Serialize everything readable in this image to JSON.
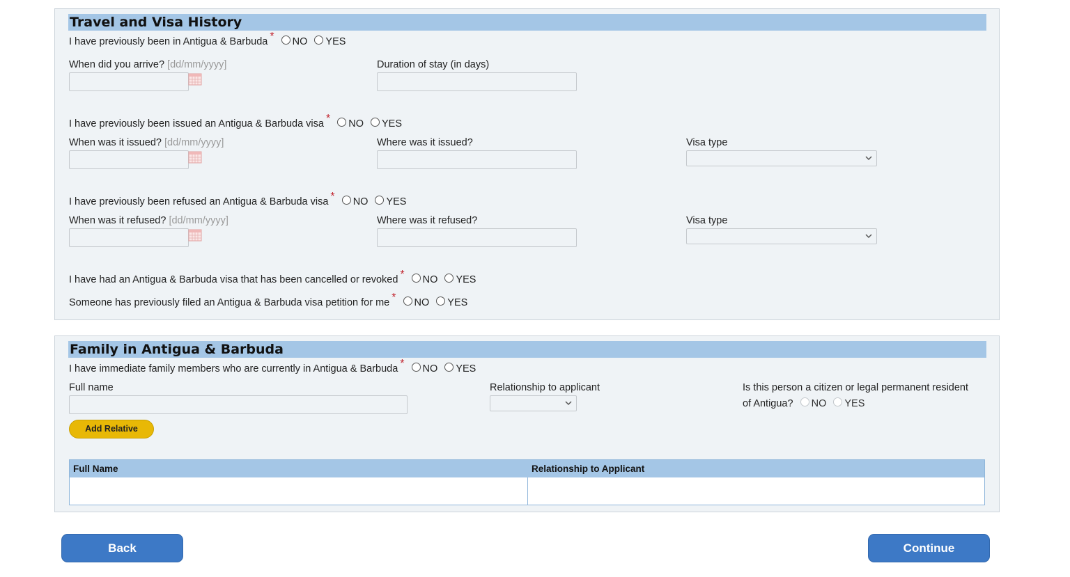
{
  "travel": {
    "title": "Travel and Visa History",
    "q_been": "I have previously been in Antigua & Barbuda",
    "arrive_label": "When did you arrive?",
    "date_hint": "[dd/mm/yyyy]",
    "duration_label": "Duration of stay (in days)",
    "q_issued": "I have previously been issued an Antigua & Barbuda visa",
    "issued_when_label": "When was it issued?",
    "issued_where_label": "Where was it issued?",
    "visa_type_label": "Visa type",
    "q_refused": "I have previously been refused an Antigua & Barbuda visa",
    "refused_when_label": "When was it refused?",
    "refused_where_label": "Where was it refused?",
    "q_cancelled": "I have had an Antigua & Barbuda visa that has been cancelled or revoked",
    "q_petition": "Someone has previously filed an Antigua & Barbuda visa petition for me"
  },
  "options": {
    "no": "NO",
    "yes": "YES",
    "required_mark": "*"
  },
  "family": {
    "title": "Family in Antigua & Barbuda",
    "q_family": "I have immediate family members who are currently in Antigua & Barbuda",
    "full_name_label": "Full name",
    "relationship_label": "Relationship to applicant",
    "citizen_label_line1": "Is this person a citizen or legal permanent resident",
    "citizen_label_line2": "of Antigua?",
    "add_button": "Add Relative",
    "table_headers": [
      "Full Name",
      "Relationship to Applicant"
    ]
  },
  "nav": {
    "back": "Back",
    "continue": "Continue"
  },
  "colors": {
    "section_header": "#a4c6e6",
    "panel_bg": "#eff3f6",
    "primary_button": "#3d79c6",
    "add_button": "#e8b806",
    "required": "#c0202a"
  },
  "icons": {
    "calendar": "calendar-icon",
    "dropdown": "chevron-down-icon"
  }
}
